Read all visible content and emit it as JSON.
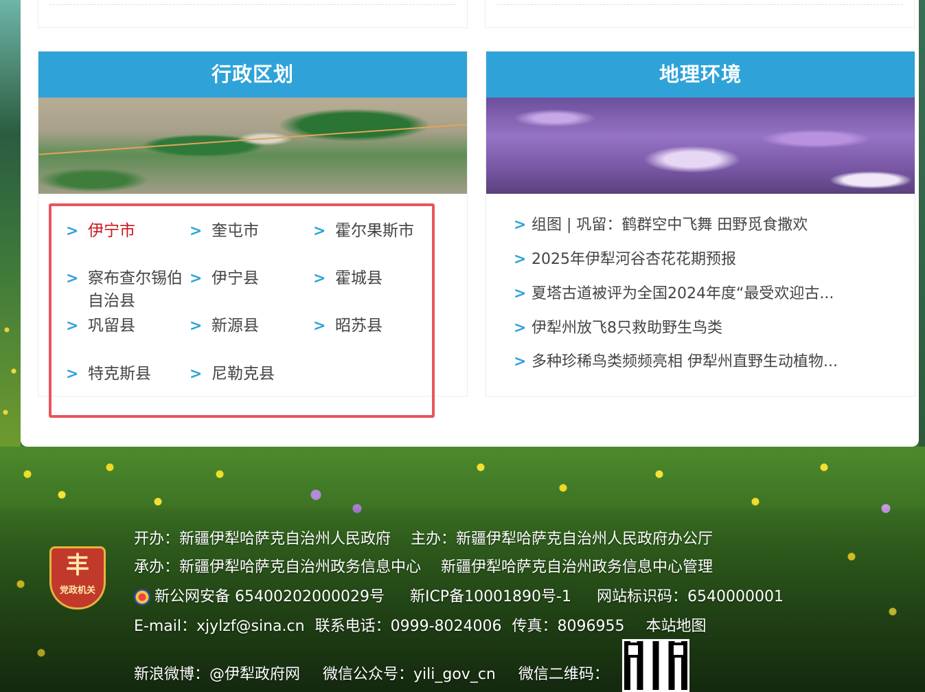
{
  "admin_panel": {
    "title": "行政区划",
    "items": [
      {
        "label": "伊宁市"
      },
      {
        "label": "奎屯市"
      },
      {
        "label": "霍尔果斯市"
      },
      {
        "label": "察布查尔锡伯自治县"
      },
      {
        "label": "伊宁县"
      },
      {
        "label": "霍城县"
      },
      {
        "label": "巩留县"
      },
      {
        "label": "新源县"
      },
      {
        "label": "昭苏县"
      },
      {
        "label": "特克斯县"
      },
      {
        "label": "尼勒克县"
      }
    ]
  },
  "geo_panel": {
    "title": "地理环境",
    "news": [
      {
        "label": "组图 | 巩留：鹤群空中飞舞 田野觅食撒欢"
      },
      {
        "label": "2025年伊犁河谷杏花花期预报"
      },
      {
        "label": "夏塔古道被评为全国2024年度“最受欢迎古..."
      },
      {
        "label": "伊犁州放飞8只救助野生鸟类"
      },
      {
        "label": "多种珍稀鸟类频频亮相 伊犁州直野生动植物..."
      }
    ]
  },
  "footer": {
    "emblem_text": "党政机关",
    "organizer": "开办：新疆伊犁哈萨克自治州人民政府",
    "sponsor": "主办：新疆伊犁哈萨克自治州人民政府办公厅",
    "undertaker": "承办：新疆伊犁哈萨克自治州政务信息中心",
    "manager": "新疆伊犁哈萨克自治州政务信息中心管理",
    "police_record": "新公网安备 65400202000029号",
    "icp": "新ICP备10001890号-1",
    "site_id": "网站标识码：6540000001",
    "email": "E-mail：xjylzf@sina.cn",
    "phone": "联系电话：0999-8024006",
    "fax": "传真：8096955",
    "sitemap": "本站地图",
    "weibo": "新浪微博：@伊犁政府网",
    "wechat": "微信公众号：yili_gov_cn",
    "wechat_qr": "微信二维码："
  },
  "colors": {
    "header_blue": "#2fa3d8",
    "active_red": "#c8161d",
    "highlight_border": "#e8555c"
  }
}
